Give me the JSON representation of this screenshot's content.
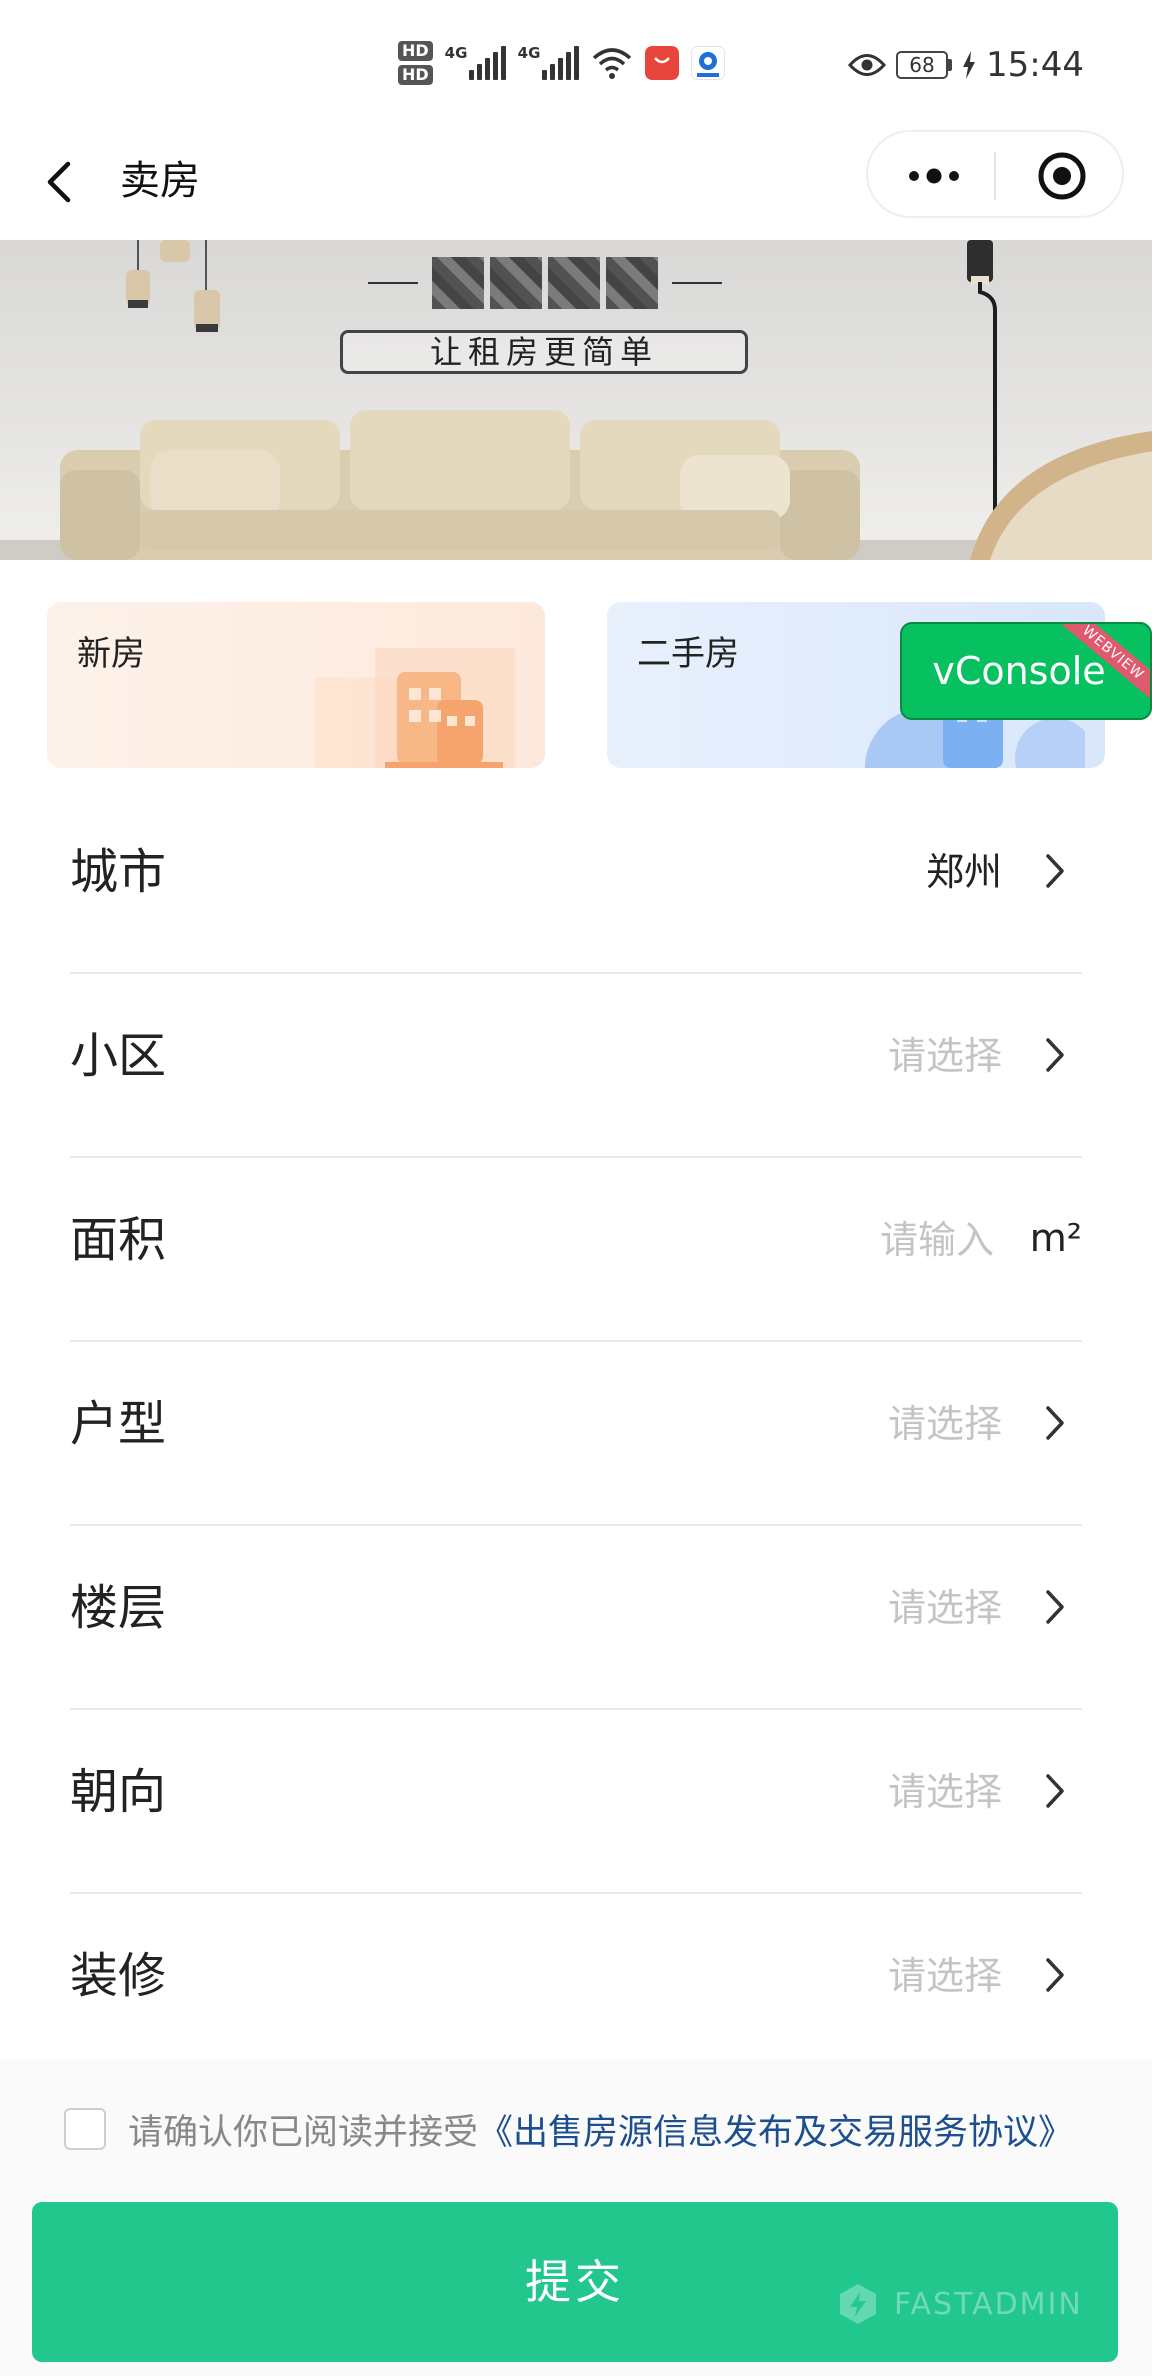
{
  "status_bar": {
    "hd1": "HD",
    "hd2": "HD",
    "net1": "4G",
    "net2": "4G",
    "battery_level": "68",
    "time": "15:44"
  },
  "nav": {
    "title": "卖房"
  },
  "banner": {
    "subtitle": "让租房更简单"
  },
  "cards": [
    {
      "label": "新房"
    },
    {
      "label": "二手房"
    }
  ],
  "vconsole": {
    "label": "vConsole",
    "ribbon": "WEBVIEW"
  },
  "form": {
    "city": {
      "label": "城市",
      "value": "郑州"
    },
    "community": {
      "label": "小区",
      "placeholder": "请选择"
    },
    "area": {
      "label": "面积",
      "placeholder": "请输入",
      "unit": "m²"
    },
    "layout": {
      "label": "户型",
      "placeholder": "请选择"
    },
    "floor": {
      "label": "楼层",
      "placeholder": "请选择"
    },
    "orientation": {
      "label": "朝向",
      "placeholder": "请选择"
    },
    "decoration": {
      "label": "装修",
      "placeholder": "请选择"
    }
  },
  "agreement": {
    "prefix": "请确认你已阅读并接受",
    "link": "《出售房源信息发布及交易服务协议》",
    "checked": false
  },
  "submit": {
    "label": "提交"
  },
  "watermark": {
    "text": "FASTADMIN"
  },
  "colors": {
    "primary_green": "#22c78e",
    "vconsole_green": "#07c160",
    "link_blue": "#1d4f8f",
    "placeholder_gray": "#c4c4c4"
  }
}
